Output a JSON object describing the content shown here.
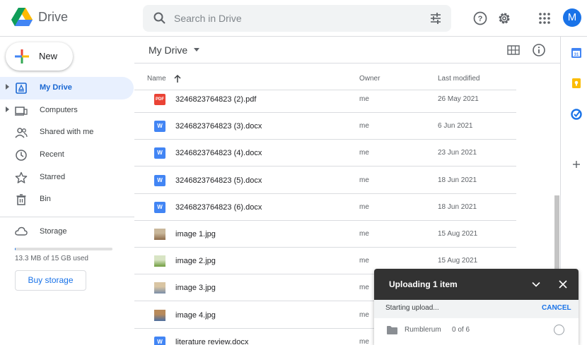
{
  "header": {
    "app_title": "Drive",
    "search_placeholder": "Search in Drive",
    "avatar_initial": "M"
  },
  "sidebar": {
    "new_label": "New",
    "items": [
      {
        "label": "My Drive",
        "icon": "my-drive-icon",
        "active": true,
        "expandable": true
      },
      {
        "label": "Computers",
        "icon": "computer-icon",
        "active": false,
        "expandable": true
      },
      {
        "label": "Shared with me",
        "icon": "people-icon",
        "active": false,
        "expandable": false
      },
      {
        "label": "Recent",
        "icon": "clock-icon",
        "active": false,
        "expandable": false
      },
      {
        "label": "Starred",
        "icon": "star-icon",
        "active": false,
        "expandable": false
      },
      {
        "label": "Bin",
        "icon": "trash-icon",
        "active": false,
        "expandable": false
      }
    ],
    "storage_label": "Storage",
    "storage_used_text": "13.3 MB of 15 GB used",
    "storage_fraction": 0.001,
    "buy_storage_label": "Buy storage"
  },
  "main": {
    "title": "My Drive",
    "columns": {
      "name": "Name",
      "owner": "Owner",
      "modified": "Last modified"
    },
    "files": [
      {
        "name": "3246823764823 (2).pdf",
        "type": "pdf",
        "owner": "me",
        "modified": "26 May 2021"
      },
      {
        "name": "3246823764823 (3).docx",
        "type": "docx",
        "owner": "me",
        "modified": "6 Jun 2021"
      },
      {
        "name": "3246823764823 (4).docx",
        "type": "docx",
        "owner": "me",
        "modified": "23 Jun 2021"
      },
      {
        "name": "3246823764823 (5).docx",
        "type": "docx",
        "owner": "me",
        "modified": "18 Jun 2021"
      },
      {
        "name": "3246823764823 (6).docx",
        "type": "docx",
        "owner": "me",
        "modified": "18 Jun 2021"
      },
      {
        "name": "image 1.jpg",
        "type": "jpg",
        "owner": "me",
        "modified": "15 Aug 2021"
      },
      {
        "name": "image 2.jpg",
        "type": "jpg",
        "owner": "me",
        "modified": "15 Aug 2021"
      },
      {
        "name": "image 3.jpg",
        "type": "jpg",
        "owner": "me",
        "modified": ""
      },
      {
        "name": "image 4.jpg",
        "type": "jpg",
        "owner": "me",
        "modified": ""
      },
      {
        "name": "literature review.docx",
        "type": "docx",
        "owner": "me",
        "modified": ""
      }
    ]
  },
  "upload_panel": {
    "title": "Uploading 1 item",
    "status": "Starting upload...",
    "cancel_label": "CANCEL",
    "item_name": "Rumblerum",
    "item_progress": "0 of 6"
  },
  "colors": {
    "accent": "#1a73e8",
    "active_nav_bg": "#e8f0fe",
    "pdf": "#ea4335",
    "docx": "#4285f4",
    "upload_header": "#323232"
  }
}
